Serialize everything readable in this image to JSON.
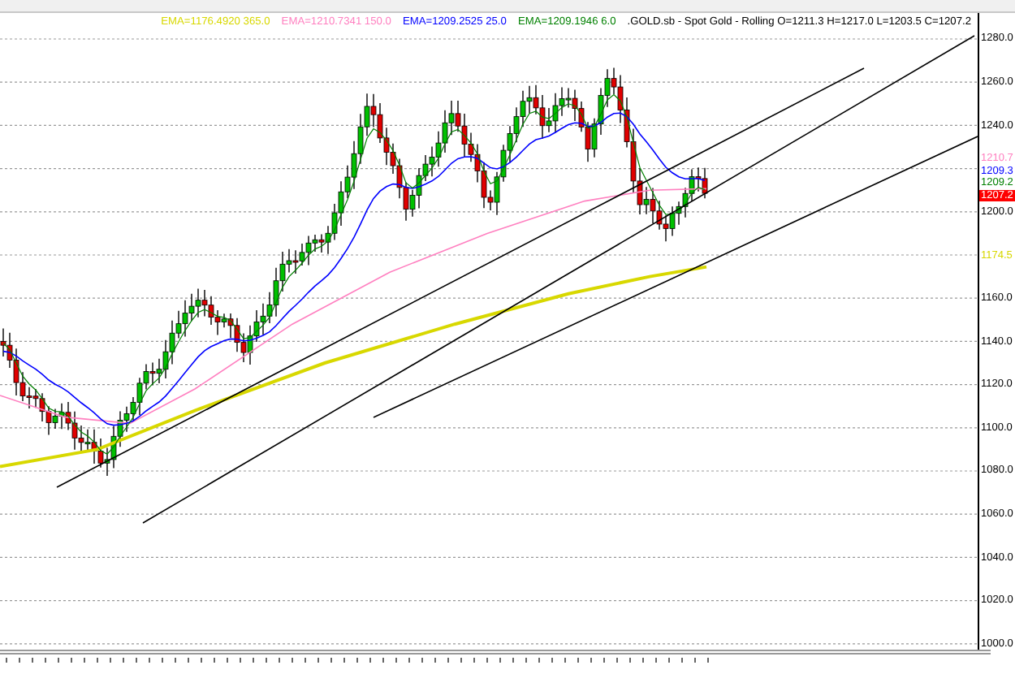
{
  "legend": [
    {
      "text": "EMA=1176.4920  365.0",
      "color": "#d8d800"
    },
    {
      "text": "EMA=1210.7341  150.0",
      "color": "#ff80c0"
    },
    {
      "text": "EMA=1209.2525  25.0",
      "color": "#0000ff"
    },
    {
      "text": "EMA=1209.1946  6.0",
      "color": "#008000"
    },
    {
      "text": ".GOLD.sb - Spot Gold - Rolling O=1211.3 H=1217.0 L=1203.5 C=1207.2",
      "color": "#000000"
    }
  ],
  "y_axis": [
    "1280.0",
    "1260.0",
    "1240.0",
    "1200.0",
    "1160.0",
    "1140.0",
    "1120.0",
    "1100.0",
    "1080.0",
    "1060.0",
    "1040.0",
    "1020.0",
    "1000.0"
  ],
  "price_tags": [
    {
      "text": "1210.7",
      "color": "#ff80c0",
      "kind": "label"
    },
    {
      "text": "1209.3",
      "color": "#0000ff",
      "kind": "label"
    },
    {
      "text": "1209.2",
      "color": "#008000",
      "kind": "label"
    },
    {
      "text": "1207.2",
      "color": "#ff0000",
      "kind": "highlight"
    },
    {
      "text": "1174.5",
      "color": "#d8d800",
      "kind": "label"
    }
  ]
}
